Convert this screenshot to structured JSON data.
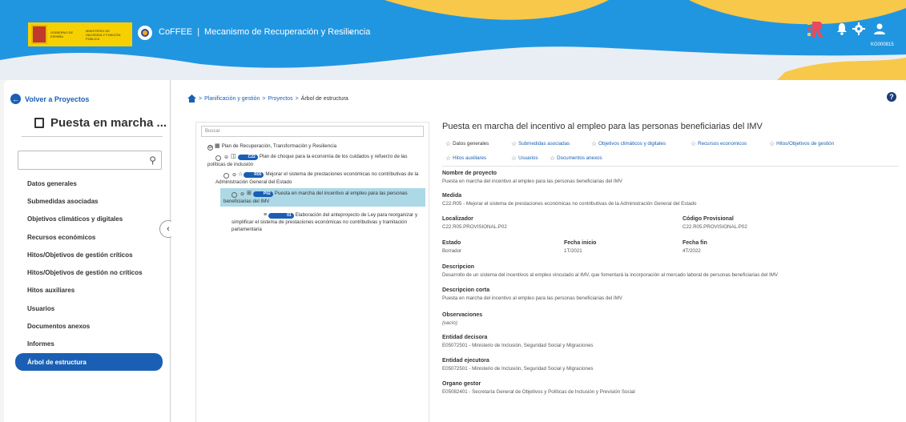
{
  "header": {
    "logo_text_a": "GOBIERNO DE ESPAÑA",
    "logo_text_b": "MINISTERIO DE HACIENDA Y FUNCIÓN PÚBLICA",
    "app_name": "CoFFEE",
    "separator": "|",
    "module": "Mecanismo de Recuperación y Resiliencia",
    "user_code": "KG000815",
    "colors": {
      "primary": "#2196e0",
      "wave": "#f7c84a",
      "brand_dark": "#1a5fb4"
    }
  },
  "sidebar": {
    "back_label": "Volver a Proyectos",
    "project_title": "Puesta en marcha ...",
    "search_placeholder": "",
    "items": [
      {
        "label": "Datos generales"
      },
      {
        "label": "Submedidas asociadas"
      },
      {
        "label": "Objetivos climáticos y digitales"
      },
      {
        "label": "Recursos económicos"
      },
      {
        "label": "Hitos/Objetivos de gestión críticos"
      },
      {
        "label": "Hitos/Objetivos de gestión no críticos"
      },
      {
        "label": "Hitos auxiliares"
      },
      {
        "label": "Usuarios"
      },
      {
        "label": "Documentos anexos"
      },
      {
        "label": "Informes"
      },
      {
        "label": "Árbol de estructura"
      }
    ],
    "active_item": "Árbol de estructura"
  },
  "breadcrumb": {
    "items": [
      "Planificación y gestión",
      "Proyectos"
    ],
    "current": "Árbol de estructura",
    "sep": ">"
  },
  "tree": {
    "search_placeholder": "Buscar",
    "nodes": [
      {
        "toggle": "⊖",
        "icon": "plan-icon",
        "badge": "",
        "text": "Plan de Recuperación, Transformación y Resiliencia"
      },
      {
        "toggle": "⊖",
        "icon": "component-icon",
        "badge": "C22",
        "text": "Plan de choque para la economía de los cuidados y refuerzo de las políticas de inclusión"
      },
      {
        "toggle": "⊖",
        "icon": "institution-icon",
        "badge": "R05",
        "text": "Mejorar el sistema de prestaciones económicas no contributivas de la Administración General del Estado"
      },
      {
        "toggle": "⊖",
        "icon": "grid-icon",
        "badge": "P02",
        "text": "Puesta en marcha del incentivo al empleo para las personas beneficiarias del IMV"
      },
      {
        "toggle": "",
        "icon": "list-icon",
        "badge": "01",
        "text": "Elaboración del anteproyecto de Ley para reorganizar y simplificar el sistema de prestaciones económicas no contributivas y tramitación parlamentaria"
      }
    ]
  },
  "detail": {
    "title": "Puesta en marcha del incentivo al empleo para las personas beneficiarias del IMV",
    "tabs": [
      "Datos generales",
      "Submedidas asociadas",
      "Objetivos climáticos y digitales",
      "Recursos economicos",
      "Hitos/Objetivos de gestión",
      "Hitos auxiliares",
      "Usuarios",
      "Documentos anexos"
    ],
    "fields": {
      "nombre_label": "Nombre de proyecto",
      "nombre": "Puesta en marcha del incentivo al empleo para las personas beneficiarias del IMV",
      "medida_label": "Medida",
      "medida": "C22.R05 - Mejorar el sistema de prestaciones económicas no contributivas de la Administración General del Estado",
      "localizador_label": "Localizador",
      "localizador": "C22.R05.PROVISIONAL.P02",
      "codigo_label": "Código Provisional",
      "codigo": "C22.R05.PROVISIONAL.P02",
      "estado_label": "Estado",
      "estado": "Borrador",
      "fecha_inicio_label": "Fecha inicio",
      "fecha_inicio": "1T/2021",
      "fecha_fin_label": "Fecha fin",
      "fecha_fin": "4T/2022",
      "descripcion_label": "Descripcion",
      "descripcion": "Desarrollo de un sistema del incentivos al empleo vinculado al IMV, que fomentará la incorporación al mercado laboral de personas beneficiarias del IMV",
      "desc_corta_label": "Descripcion corta",
      "desc_corta": "Puesta en marcha del incentivo al empleo para las personas beneficiarias del IMV",
      "observaciones_label": "Observaciones",
      "observaciones": "(vacío)",
      "decisora_label": "Entidad decisora",
      "decisora": "E05072501 - Ministerio de Inclusión, Seguridad Social y Migraciones",
      "ejecutora_label": "Entidad ejecutora",
      "ejecutora": "E05072501 - Ministerio de Inclusión, Seguridad Social y Migraciones",
      "organo_label": "Organo gestor",
      "organo": "E05082401 - Secretaría General de Objetivos y Políticas de Inclusión y Previsión Social"
    }
  }
}
